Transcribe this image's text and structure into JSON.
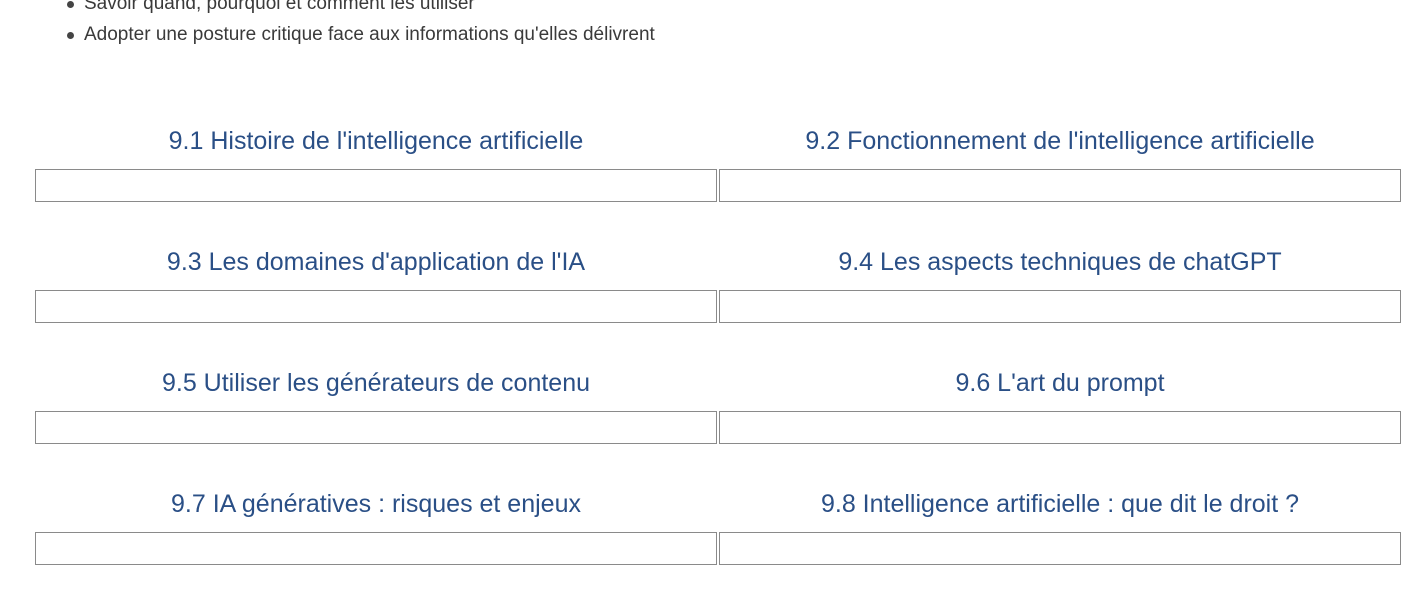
{
  "objectives": [
    "Savoir quand, pourquoi et comment les utiliser",
    "Adopter une posture critique face aux informations qu'elles délivrent"
  ],
  "modules": [
    {
      "title": "9.1 Histoire de l'intelligence artificielle"
    },
    {
      "title": "9.2 Fonctionnement de l'intelligence artificielle"
    },
    {
      "title": "9.3 Les domaines d'application de l'IA"
    },
    {
      "title": "9.4 Les aspects techniques de chatGPT"
    },
    {
      "title": "9.5 Utiliser les générateurs de contenu"
    },
    {
      "title": "9.6 L'art du prompt"
    },
    {
      "title": "9.7 IA génératives : risques et enjeux"
    },
    {
      "title": "9.8 Intelligence artificielle : que dit le droit ?"
    }
  ],
  "colors": {
    "title": "#2a4f86",
    "text": "#3a3a3a",
    "border": "#8a8a8a"
  }
}
